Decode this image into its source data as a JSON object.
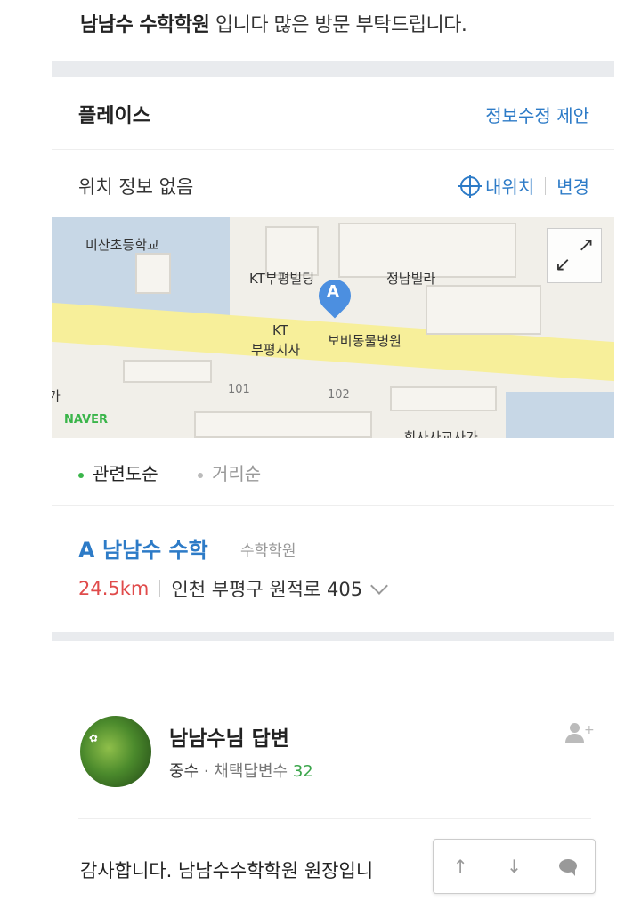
{
  "intro": {
    "name": "남남수 수학학원",
    "rest": " 입니다 많은 방문 부탁드립니다."
  },
  "place": {
    "title": "플레이스",
    "suggest": "정보수정 제안"
  },
  "location": {
    "status": "위치 정보 없음",
    "my_location": "내위치",
    "change": "변경"
  },
  "map": {
    "labels": {
      "school": "미산초등학교",
      "building": "KT부평빌딩",
      "villa": "정남빌라",
      "kt_branch_1": "KT",
      "kt_branch_2": "부평지사",
      "animal_hospital": "보비동물병원",
      "road_101": "101",
      "road_102": "102",
      "left_edge": "가",
      "bottom": "한사사교사가"
    },
    "pin_letter": "A",
    "brand": "NAVER"
  },
  "sort": {
    "relevance": "관련도순",
    "distance": "거리순"
  },
  "result": {
    "letter": "A",
    "name": "남남수 수학",
    "category": "수학학원",
    "distance": "24.5km",
    "address": "인천 부평구 원적로 405"
  },
  "answer": {
    "name": "남남수님 답변",
    "grade": "중수",
    "meta_label": " · 채택답변수 ",
    "count": "32",
    "reply_text": "감사합니다. 남남수수학학원 원장입니"
  },
  "colors": {
    "link_blue": "#2d7bc7",
    "distance_red": "#e04b4b",
    "count_green": "#3aa54a",
    "naver_green": "#3ab54a"
  }
}
